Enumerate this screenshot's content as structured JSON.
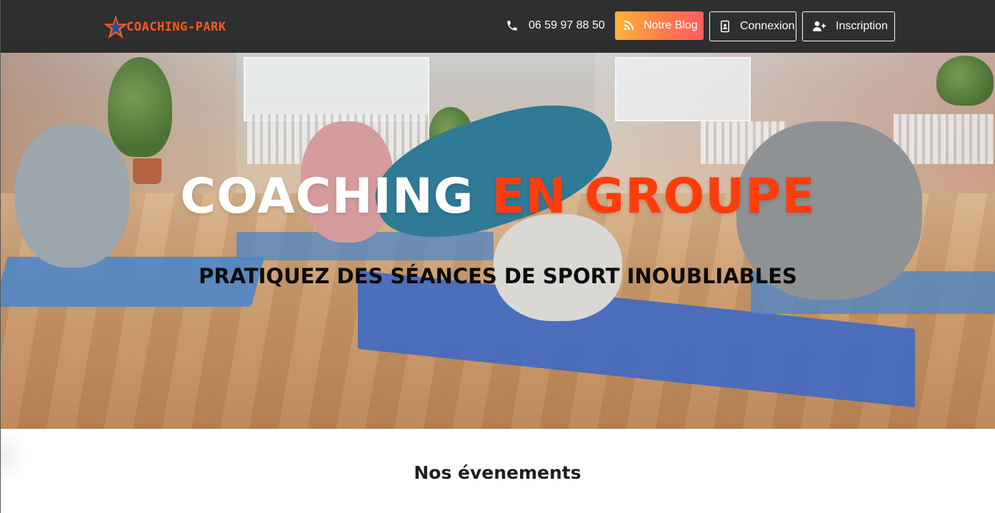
{
  "brand": {
    "name": "COACHING-PARK"
  },
  "header": {
    "phone": "06 59 97 88 50",
    "blog_label": "Notre Blog",
    "login_label": "Connexion",
    "signup_label": "Inscription"
  },
  "hero": {
    "title_main": "COACHING",
    "title_accent": "EN GROUPE",
    "subtitle": "PRATIQUEZ DES SÉANCES DE SPORT INOUBLIABLES"
  },
  "events": {
    "title": "Nos évenements"
  },
  "colors": {
    "accent": "#ff3d0c",
    "navbar": "#282828",
    "blog_gradient": [
      "#fdb33a",
      "#ff5e62"
    ]
  },
  "icons": {
    "brand": "star-icon",
    "phone": "phone-icon",
    "blog": "rss-icon",
    "login": "id-card-icon",
    "signup": "user-plus-icon"
  }
}
